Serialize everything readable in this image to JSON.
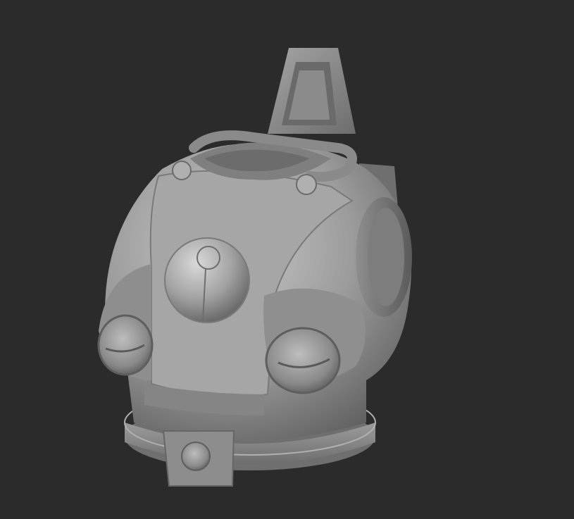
{
  "scene": {
    "subject": "sculpted-armor-torso",
    "background_color": "#2b2b2b",
    "material_color": "#9a9a9a"
  }
}
